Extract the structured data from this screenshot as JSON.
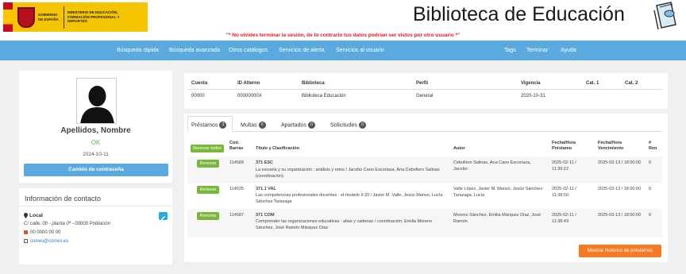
{
  "header": {
    "gov_text": "GOBIERNO DE ESPAÑA",
    "ministry_text": "MINISTERIO DE EDUCACIÓN, FORMACIÓN PROFESIONAL Y DEPORTES",
    "site_title": "Biblioteca de Educación",
    "warning": "\"* No olvides terminar la sesión, de lo contrario tus datos podrían ser vistos por otro usuario *\""
  },
  "nav": {
    "left": [
      "Búsqueda rápida",
      "Búsqueda avanzada",
      "Otros catálogos",
      "Servicios de alerta",
      "Servicios al usuario"
    ],
    "right": [
      "Tags",
      "Terminar",
      "Ayuda"
    ]
  },
  "profile": {
    "name": "Apellidos, Nombre",
    "status": "OK",
    "date": "2024-10-11",
    "change_password": "Cambio de contraseña"
  },
  "contact": {
    "title": "Información de contacto",
    "location_label": "Local",
    "address": "C/ calle, 00 - planta 0ª - 00000 Población",
    "phone": "00 0000 00 00",
    "email": "correo@correo.es"
  },
  "account": {
    "headers": [
      "Cuenta",
      "ID Alterno",
      "Biblioteca",
      "Perfil",
      "Vigencia",
      "Cat. 1",
      "Cat. 2"
    ],
    "row": [
      "00000",
      "00000000X",
      "Biblioteca Educación",
      "General",
      "2020-10-31",
      "",
      ""
    ]
  },
  "tabs": [
    {
      "label": "Préstamos",
      "count": "3"
    },
    {
      "label": "Multas",
      "count": "0"
    },
    {
      "label": "Apartados",
      "count": "0"
    },
    {
      "label": "Solicitudes",
      "count": "0"
    }
  ],
  "loans": {
    "renew_all": "Renovar todos",
    "headers": {
      "code": "Cod. Barras",
      "title": "Título y Clasificación",
      "author": "Autor",
      "loan_date": "Fecha/Hora Préstamo",
      "due_date": "Fecha/Hora Vencimiento",
      "renewals": "# Ren"
    },
    "renew_label": "Renovar",
    "rows": [
      {
        "code": "114589",
        "classification": "371 ESC",
        "title": "La escuela y su organización : análisis y retos / Jacobo Cano Escoriaza, Ana Cebollero Salinas (coordinación)",
        "author": "Cebollero Salinas, Ana Cano Escoriaza, Jacobo",
        "loan_date": "2025-02-11 / 11:39:22",
        "due_date": "2025-03-13 / 18:00:00",
        "renewals": "0"
      },
      {
        "code": "114025",
        "classification": "371.1 VAL",
        "title": "Las competencias profesionales docentes : el modelo 9:20 / Javier M. Valle, Jesús Manso, Lucía Sánchez Tarazaga",
        "author": "Valle López, Javier M. Manso, Jesús Sánchez-Tarazaga, Lucía",
        "loan_date": "2025-02-11 / 11:38:50",
        "due_date": "2025-03-13 / 18:00:00",
        "renewals": "0"
      },
      {
        "code": "114587",
        "classification": "371 COM",
        "title": "Comprender las organizaciones educativas : altas y cadenas / coordinación, Emilia Moreno Sánchez, José Ramón Márquez Díaz",
        "author": "Moreno Sánchez, Emilia Márquez Díaz, José Ramón",
        "loan_date": "2025-02-11 / 11:38:43",
        "due_date": "2025-03-13 / 18:00:00",
        "renewals": "0"
      }
    ],
    "history_button": "Mostrar histórico de préstamos"
  },
  "colors": {
    "nav_bg": "#5aaae0",
    "renew_green": "#7ab63c",
    "history_orange": "#f47a26",
    "status_ok": "#5cb85c",
    "warning_red": "#e21b1b"
  }
}
